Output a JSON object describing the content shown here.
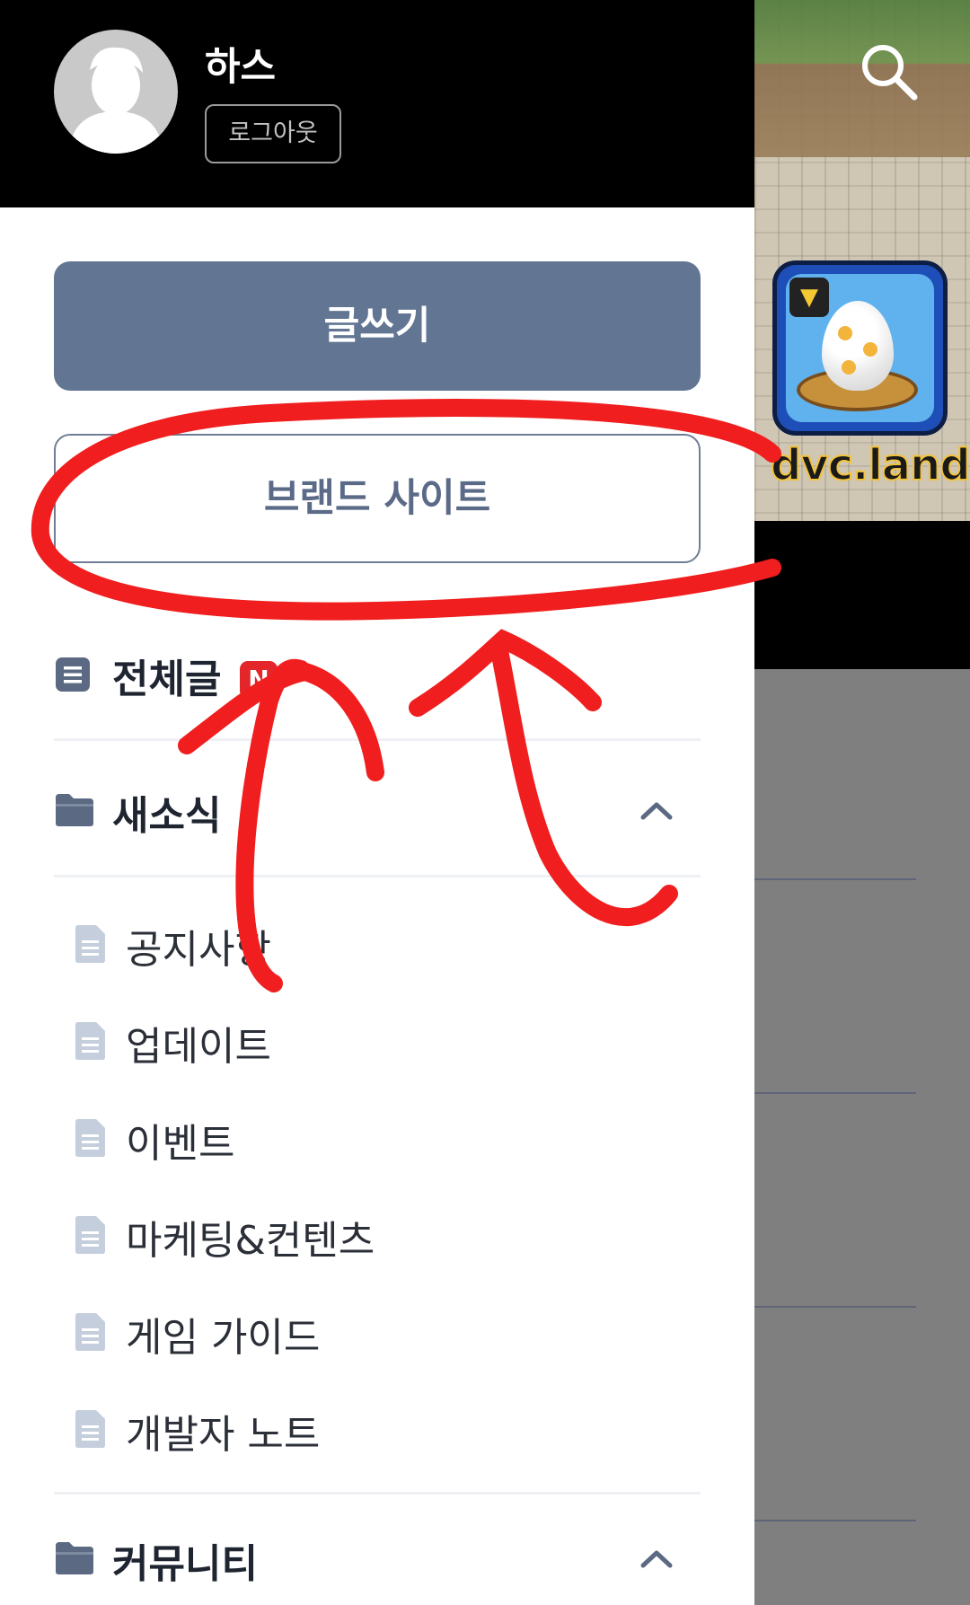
{
  "profile": {
    "username": "하스",
    "logout_label": "로그아웃"
  },
  "actions": {
    "write_label": "글쓰기",
    "brand_site_label": "브랜드 사이트"
  },
  "all_posts": {
    "label": "전체글",
    "new_badge": "N"
  },
  "folders": [
    {
      "label": "새소식",
      "expanded": true,
      "items": [
        {
          "label": "공지사항"
        },
        {
          "label": "업데이트"
        },
        {
          "label": "이벤트"
        },
        {
          "label": "마케팅&컨텐츠"
        },
        {
          "label": "게임 가이드"
        },
        {
          "label": "개발자 노트"
        }
      ]
    },
    {
      "label": "커뮤니티",
      "expanded": true
    }
  ],
  "background": {
    "brand_text": "dvc.land"
  },
  "colors": {
    "header_bg": "#000000",
    "primary_button": "#627694",
    "outline_button_text": "#5a6a87",
    "new_badge": "#e2262a",
    "annotation_red": "#f01e1e",
    "overlay": "#7f7f7f"
  },
  "icons": {
    "search": "search-icon",
    "avatar": "default-avatar-icon",
    "document": "document-icon",
    "folder": "folder-icon",
    "chevron": "chevron-up-icon"
  }
}
